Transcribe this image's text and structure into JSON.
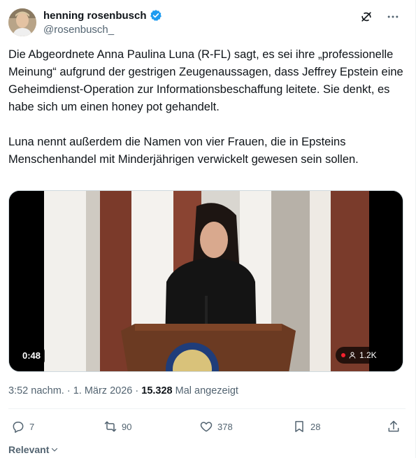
{
  "author": {
    "display_name": "henning rosenbusch",
    "handle": "@rosenbusch_",
    "verified_color": "#1d9bf0"
  },
  "post": {
    "text": "Die Abgeordnete Anna Paulina Luna (R-FL) sagt, es sei ihre „professionelle Meinung“ aufgrund der gestrigen Zeugenaussagen, dass Jeffrey Epstein eine Geheimdienst-Operation zur Informationsbeschaffung leitete. Sie denkt, es habe sich um einen honey pot gehandelt.\n\nLuna nennt außerdem die Namen von vier Frauen, die in Epsteins Menschenhandel mit Minderjährigen verwickelt gewesen sein sollen.",
    "video_duration": "0:48",
    "live_viewers": "1.2K",
    "time": "3:52 nachm.",
    "separator": "·",
    "date": "1. März 2026",
    "views_count": "15.328",
    "views_label": "Mal angezeigt"
  },
  "actions": {
    "replies": "7",
    "reposts": "90",
    "likes": "378",
    "bookmarks": "28"
  },
  "footer": {
    "relevant_label": "Relevant"
  },
  "icons": {
    "top": [
      "grok-icon",
      "more-icon"
    ],
    "actions": [
      "reply-icon",
      "repost-icon",
      "like-icon",
      "bookmark-icon",
      "share-icon"
    ]
  },
  "colors": {
    "text": "#0f1419",
    "secondary": "#536471",
    "accent": "#1d9bf0",
    "live": "#f4212e"
  }
}
